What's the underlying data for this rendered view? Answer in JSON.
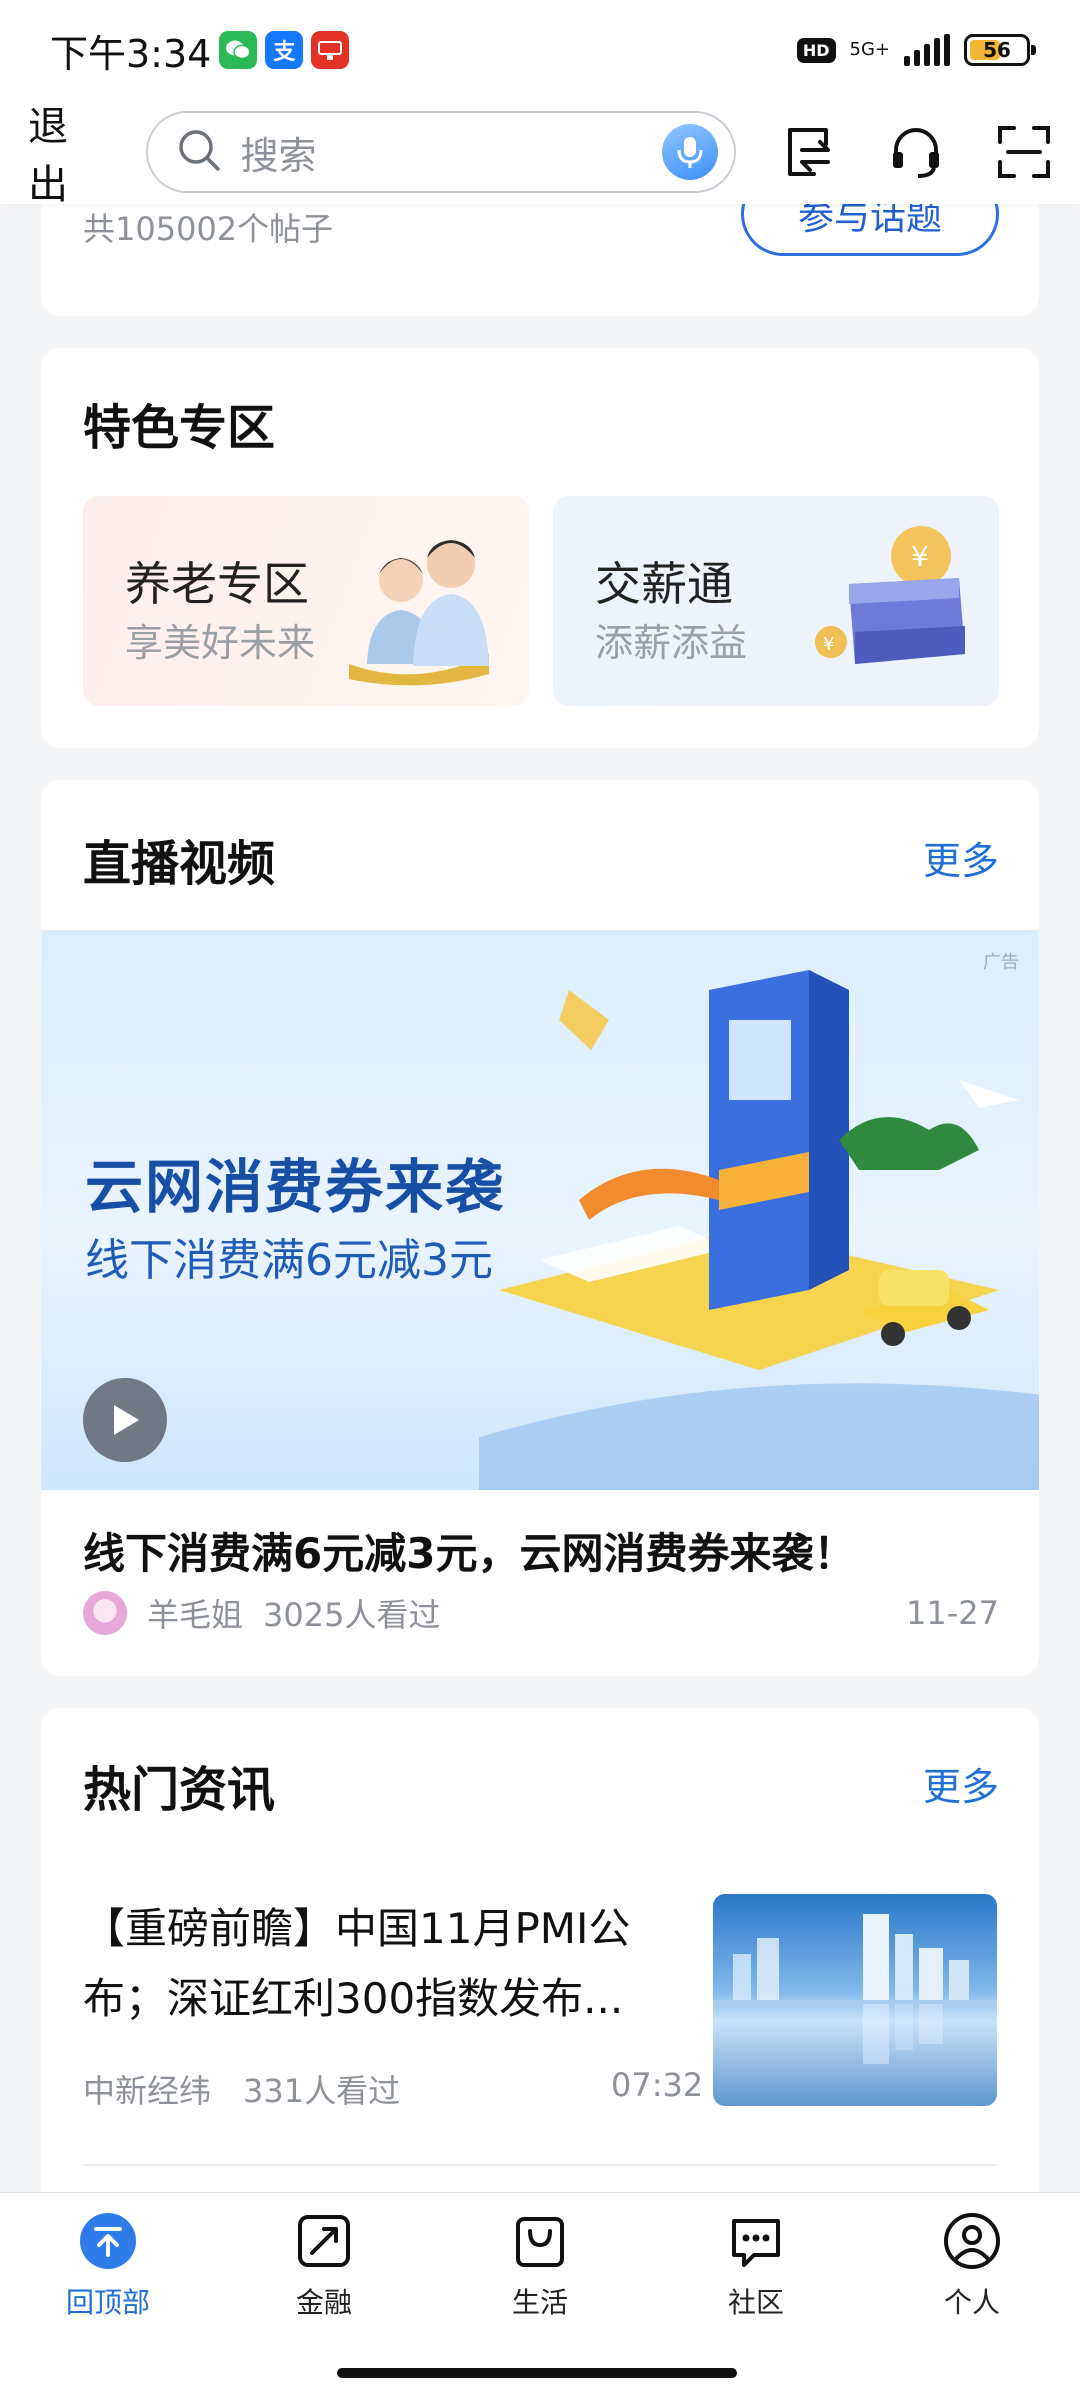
{
  "status_bar": {
    "time": "下午3:34",
    "network": "5G+",
    "hd": "HD",
    "battery": "56",
    "battery_level": 0.56,
    "app_badges": [
      "wechat-icon",
      "alipay-icon",
      "jd-icon"
    ]
  },
  "header": {
    "exit_label": "退出",
    "search_placeholder": "搜索",
    "icons": [
      "transfer-icon",
      "customer-service-icon",
      "scan-icon"
    ]
  },
  "topic": {
    "count_text": "共105002个帖子",
    "join_label": "参与话题"
  },
  "feature": {
    "title": "特色专区",
    "tiles": [
      {
        "title": "养老专区",
        "subtitle": "享美好未来"
      },
      {
        "title": "交薪通",
        "subtitle": "添薪添益"
      }
    ]
  },
  "live": {
    "title": "直播视频",
    "more_label": "更多",
    "ad_tag": "广告",
    "banner_headline": "云网消费券来袭",
    "banner_sub": "线下消费满6元减3元",
    "video_title": "线下消费满6元减3元，云网消费券来袭！",
    "author": "羊毛姐",
    "views": "3025人看过",
    "date": "11-27"
  },
  "news": {
    "title": "热门资讯",
    "more_label": "更多",
    "items": [
      {
        "title": "【重磅前瞻】中国11月PMI公布；深证红利300指数发布...",
        "source": "中新经纬",
        "views": "331人看过",
        "time": "07:32"
      }
    ]
  },
  "bottom_nav": {
    "items": [
      {
        "label": "回顶部",
        "icon": "back-to-top-icon",
        "active": true
      },
      {
        "label": "金融",
        "icon": "finance-icon",
        "active": false
      },
      {
        "label": "生活",
        "icon": "shopping-bag-icon",
        "active": false
      },
      {
        "label": "社区",
        "icon": "chat-bubble-icon",
        "active": false
      },
      {
        "label": "个人",
        "icon": "user-icon",
        "active": false
      }
    ]
  },
  "colors": {
    "accent": "#1f6fd6",
    "page_bg": "#f4f5f7",
    "card_bg": "#ffffff"
  }
}
